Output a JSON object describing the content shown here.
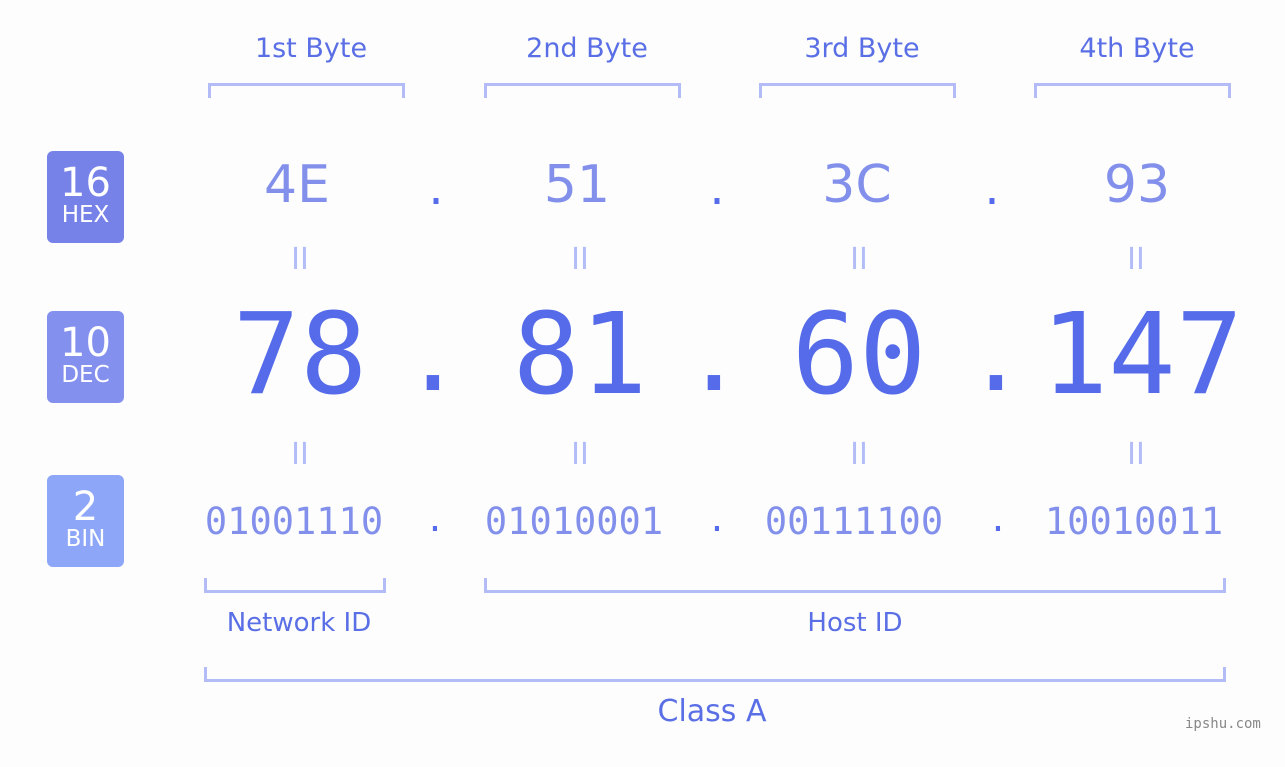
{
  "bytes": [
    {
      "label": "1st Byte",
      "hex": "4E",
      "dec": "78",
      "bin": "01001110"
    },
    {
      "label": "2nd Byte",
      "hex": "51",
      "dec": "81",
      "bin": "01010001"
    },
    {
      "label": "3rd Byte",
      "hex": "3C",
      "dec": "60",
      "bin": "00111100"
    },
    {
      "label": "4th Byte",
      "hex": "93",
      "dec": "147",
      "bin": "10010011"
    }
  ],
  "badges": {
    "hex": {
      "num": "16",
      "base": "HEX",
      "color": "#7682e8"
    },
    "dec": {
      "num": "10",
      "base": "DEC",
      "color": "#8490ee"
    },
    "bin": {
      "num": "2",
      "base": "BIN",
      "color": "#8ea6f8"
    }
  },
  "separator": ".",
  "equals": "II",
  "network_label": "Network ID",
  "host_label": "Host ID",
  "class_label": "Class A",
  "watermark": "ipshu.com"
}
